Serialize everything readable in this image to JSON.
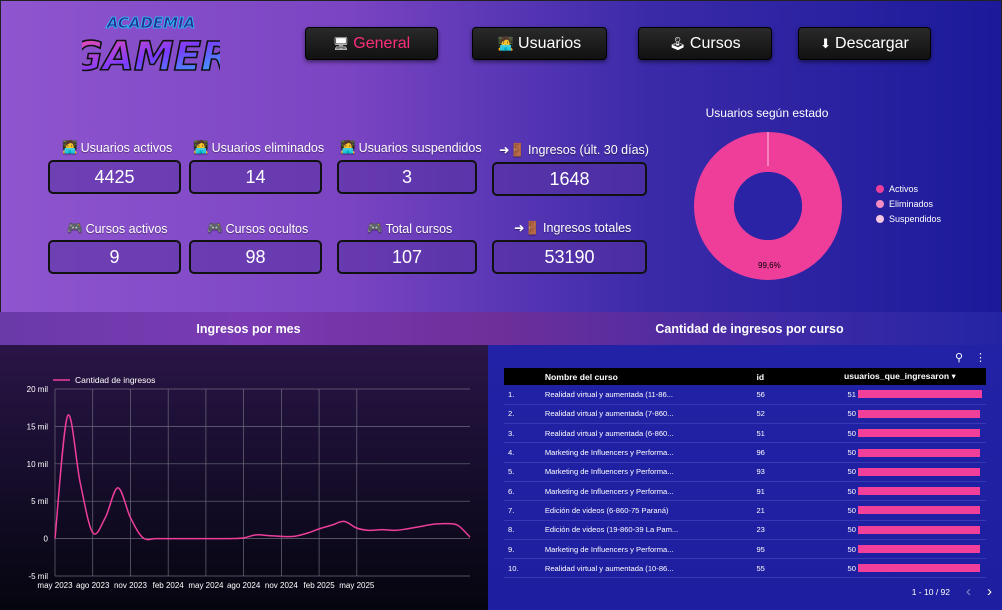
{
  "nav": [
    {
      "icon": "🖥",
      "label": "General",
      "active": true
    },
    {
      "icon": "🧑‍💻",
      "label": "Usuarios",
      "active": false
    },
    {
      "icon": "🕹",
      "label": "Cursos",
      "active": false
    },
    {
      "icon": "⬇",
      "label": "Descargar",
      "active": false
    }
  ],
  "logo": {
    "line1": "ACADEMIA",
    "line2": "GAMER"
  },
  "kpis": [
    {
      "icon": "🧑‍💻",
      "label": "Usuarios activos",
      "value": "4425"
    },
    {
      "icon": "🧑‍💻",
      "label": "Usuarios eliminados",
      "value": "14"
    },
    {
      "icon": "🧑‍💻",
      "label": "Usuarios suspendidos",
      "value": "3"
    },
    {
      "icon": "➜🚪",
      "label": "Ingresos (últ. 30 días)",
      "value": "1648"
    },
    {
      "icon": "🎮",
      "label": "Cursos activos",
      "value": "9"
    },
    {
      "icon": "🎮",
      "label": "Cursos ocultos",
      "value": "98"
    },
    {
      "icon": "🎮",
      "label": "Total cursos",
      "value": "107"
    },
    {
      "icon": "➜🚪",
      "label": "Ingresos totales",
      "value": "53190"
    }
  ],
  "donut": {
    "title": "Usuarios según estado",
    "percent_label": "99,6%",
    "legend": [
      {
        "label": "Activos",
        "color": "#ee3e9a"
      },
      {
        "label": "Eliminados",
        "color": "#f48cc4"
      },
      {
        "label": "Suspendidos",
        "color": "#f7c6e0"
      }
    ]
  },
  "sections": {
    "line_title": "Ingresos por mes",
    "table_title": "Cantidad de ingresos por curso"
  },
  "chart_data": [
    {
      "type": "line",
      "title": "Ingresos por mes",
      "series": [
        {
          "name": "Cantidad de ingresos",
          "color": "#ee3e9a",
          "values": [
            0,
            16400,
            7500,
            800,
            2800,
            6800,
            2800,
            100,
            0,
            0,
            0,
            0,
            0,
            0,
            0,
            100,
            500,
            400,
            300,
            300,
            700,
            1300,
            1800,
            2300,
            1400,
            1100,
            1200,
            1100,
            1300,
            1600,
            1900,
            2000,
            1800,
            200
          ]
        }
      ],
      "x": [
        "may 2023",
        "jun 2023",
        "jul 2023",
        "ago 2023",
        "sep 2023",
        "oct 2023",
        "nov 2023",
        "dic 2023",
        "ene 2024",
        "feb 2024",
        "mar 2024",
        "abr 2024",
        "may 2024",
        "jun 2024",
        "jul 2024",
        "ago 2024",
        "sep 2024",
        "oct 2024",
        "nov 2024",
        "dic 2024",
        "ene 2025",
        "feb 2025",
        "mar 2025",
        "abr 2025",
        "may 2025",
        "jun 2025",
        "jul 2025",
        "ago 2025",
        "sep 2025",
        "oct 2025",
        "nov 2025",
        "dic 2025",
        "ene 2026",
        "feb 2026"
      ],
      "x_ticks": [
        "may 2023",
        "ago 2023",
        "nov 2023",
        "feb 2024",
        "may 2024",
        "ago 2024",
        "nov 2024",
        "feb 2025",
        "may 2025"
      ],
      "y_ticks": [
        "20 mil",
        "15 mil",
        "10 mil",
        "5 mil",
        "0",
        "-5 mil"
      ],
      "ylim": [
        -5000,
        20000
      ],
      "grid": true,
      "legend": "top-left"
    }
  ],
  "table": {
    "headers": [
      "",
      "Nombre del curso",
      "id",
      "usuarios_que_ingresaron ▾"
    ],
    "max": 51,
    "rows": [
      {
        "n": "1.",
        "name": "Realidad virtual y aumentada (11-86...",
        "id": "56",
        "val": 51
      },
      {
        "n": "2.",
        "name": "Realidad virtual y aumentada (7-860...",
        "id": "52",
        "val": 50
      },
      {
        "n": "3.",
        "name": "Realidad virtual y aumentada (6-860...",
        "id": "51",
        "val": 50
      },
      {
        "n": "4.",
        "name": "Marketing de Influencers y Performa...",
        "id": "96",
        "val": 50
      },
      {
        "n": "5.",
        "name": "Marketing de Influencers y Performa...",
        "id": "93",
        "val": 50
      },
      {
        "n": "6.",
        "name": "Marketing de Influencers y Performa...",
        "id": "91",
        "val": 50
      },
      {
        "n": "7.",
        "name": "Edición de videos (6-860-75 Paraná)",
        "id": "21",
        "val": 50
      },
      {
        "n": "8.",
        "name": "Edición de videos (19-860-39 La Pam...",
        "id": "23",
        "val": 50
      },
      {
        "n": "9.",
        "name": "Marketing de Influencers y Performa...",
        "id": "95",
        "val": 50
      },
      {
        "n": "10.",
        "name": "Realidad virtual y aumentada (10-86...",
        "id": "55",
        "val": 50
      }
    ],
    "pager": "1 - 10 / 92"
  }
}
